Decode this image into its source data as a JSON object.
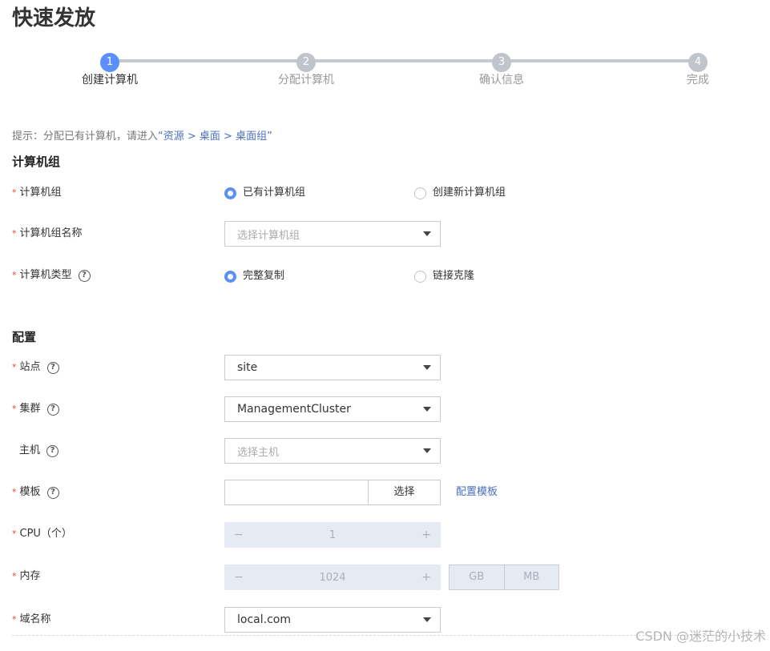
{
  "page": {
    "title": "快速发放"
  },
  "steps": [
    {
      "num": "1",
      "label": "创建计算机",
      "active": true
    },
    {
      "num": "2",
      "label": "分配计算机",
      "active": false
    },
    {
      "num": "3",
      "label": "确认信息",
      "active": false
    },
    {
      "num": "4",
      "label": "完成",
      "active": false
    }
  ],
  "hint": {
    "prefix": "提示：分配已有计算机，请进入",
    "link": "“资源 > 桌面 > 桌面组”"
  },
  "section_group": {
    "title": "计算机组"
  },
  "group": {
    "label": "计算机组",
    "options": [
      "已有计算机组",
      "创建新计算机组"
    ],
    "selected": "已有计算机组"
  },
  "group_name": {
    "label": "计算机组名称",
    "placeholder": "选择计算机组"
  },
  "computer_type": {
    "label": "计算机类型",
    "options": [
      "完整复制",
      "链接克隆"
    ],
    "selected": "完整复制"
  },
  "section_config": {
    "title": "配置"
  },
  "site": {
    "label": "站点",
    "value": "site"
  },
  "cluster": {
    "label": "集群",
    "value": "ManagementCluster"
  },
  "host": {
    "label": "主机",
    "placeholder": "选择主机"
  },
  "template": {
    "label": "模板",
    "button": "选择",
    "config_link": "配置模板"
  },
  "cpu": {
    "label": "CPU（个）",
    "value": "1",
    "minus": "−",
    "plus": "+"
  },
  "memory": {
    "label": "内存",
    "value": "1024",
    "minus": "−",
    "plus": "+",
    "units": [
      "GB",
      "MB"
    ]
  },
  "domain": {
    "label": "域名称",
    "value": "local.com"
  },
  "help_glyph": "?",
  "required_mark": "*",
  "watermark": "CSDN @迷茫的小技术",
  "colors": {
    "accent": "#5b8ff9",
    "link": "#4a6fc0",
    "required": "#e0463f"
  }
}
